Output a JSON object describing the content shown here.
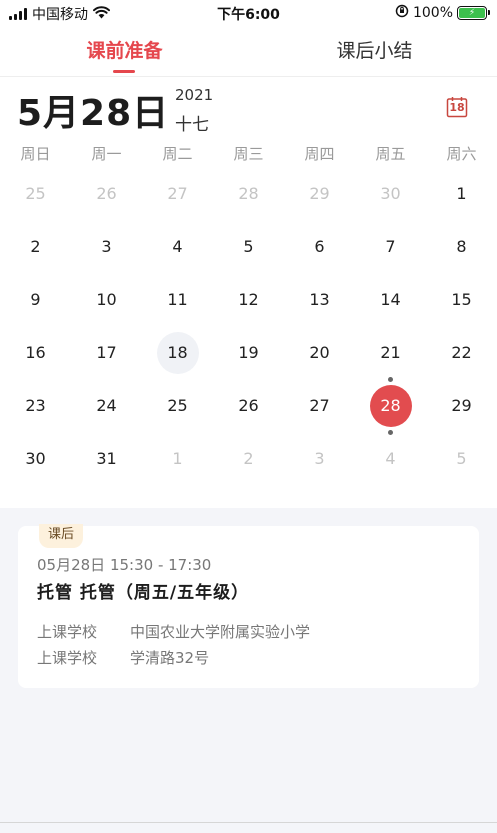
{
  "status_bar": {
    "carrier": "中国移动",
    "time": "下午6:00",
    "battery_percent": "100%",
    "icons": [
      "signal-icon",
      "wifi-icon",
      "orientation-lock-icon",
      "battery-charging-icon"
    ]
  },
  "tabs": [
    {
      "label": "课前准备",
      "active": true
    },
    {
      "label": "课后小结",
      "active": false
    }
  ],
  "date_header": {
    "month_day": "5月28日",
    "year": "2021",
    "lunar": "十七",
    "calendar_icon_day": "18"
  },
  "weekdays": [
    "周日",
    "周一",
    "周二",
    "周三",
    "周四",
    "周五",
    "周六"
  ],
  "calendar": {
    "weeks": [
      [
        "25",
        "26",
        "27",
        "28",
        "29",
        "30",
        "1"
      ],
      [
        "2",
        "3",
        "4",
        "5",
        "6",
        "7",
        "8"
      ],
      [
        "9",
        "10",
        "11",
        "12",
        "13",
        "14",
        "15"
      ],
      [
        "16",
        "17",
        "18",
        "19",
        "20",
        "21",
        "22"
      ],
      [
        "23",
        "24",
        "25",
        "26",
        "27",
        "28",
        "29"
      ],
      [
        "30",
        "31",
        "1",
        "2",
        "3",
        "4",
        "5"
      ]
    ],
    "today": "18",
    "selected": "28"
  },
  "course": {
    "badge": "课后",
    "time": "05月28日 15:30 - 17:30",
    "title": "托管 托管（周五/五年级）",
    "school_label": "上课学校",
    "school_name": "中国农业大学附属实验小学",
    "address_label": "上课学校",
    "address": "学清路32号"
  },
  "colors": {
    "accent": "#e5474d",
    "selected_day": "#e24c4f",
    "badge_bg": "#fdf1dd"
  }
}
